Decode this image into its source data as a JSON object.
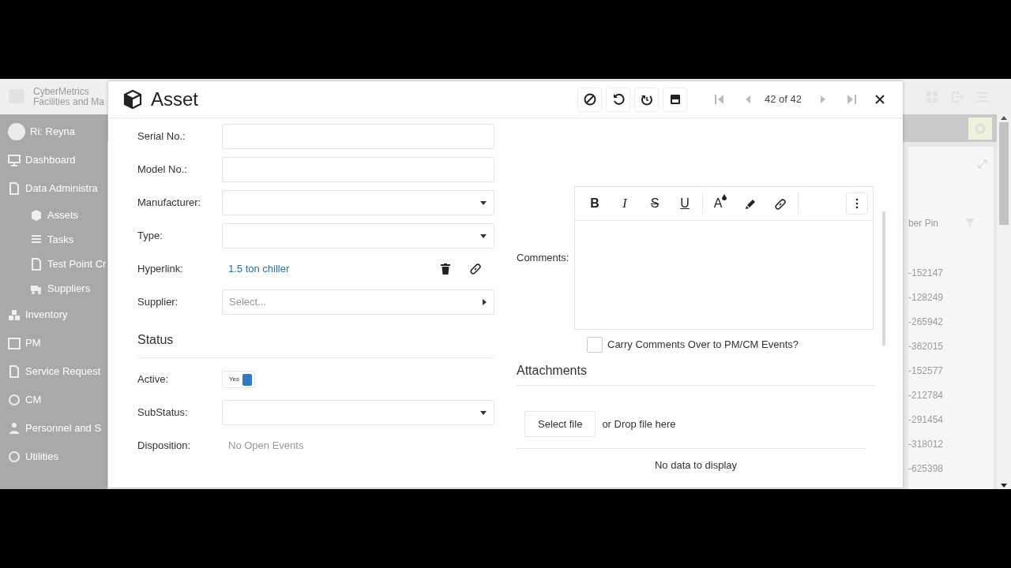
{
  "app_header": {
    "brand": "CyberMetrics",
    "tagline": "Facilities and Ma"
  },
  "sidebar": {
    "user": "Ri: Reyna",
    "items": [
      {
        "label": "Dashboard"
      },
      {
        "label": "Data Administra",
        "children": [
          {
            "label": "Assets"
          },
          {
            "label": "Tasks"
          },
          {
            "label": "Test Point Cr"
          },
          {
            "label": "Suppliers"
          }
        ]
      },
      {
        "label": "Inventory"
      },
      {
        "label": "PM"
      },
      {
        "label": "Service Request"
      },
      {
        "label": "CM"
      },
      {
        "label": "Personnel and S"
      },
      {
        "label": "Utilities"
      }
    ]
  },
  "background_table": {
    "column_header": "ber Pin",
    "cells": [
      "-152147",
      "-128249",
      "-265942",
      "-362015",
      "-152577",
      "-212784",
      "-291454",
      "-318012",
      "-625398"
    ]
  },
  "dialog": {
    "title": "Asset",
    "record_position": "42 of 42",
    "fields": [
      {
        "kind": "text",
        "label": "Serial No.:"
      },
      {
        "kind": "text",
        "label": "Model No.:"
      },
      {
        "kind": "dropdown",
        "label": "Manufacturer:"
      },
      {
        "kind": "dropdown",
        "label": "Type:"
      },
      {
        "kind": "link",
        "label": "Hyperlink:",
        "value": "1.5 ton chiller"
      },
      {
        "kind": "select",
        "label": "Supplier:",
        "placeholder": "Select..."
      }
    ],
    "status": {
      "heading": "Status",
      "fields": [
        {
          "kind": "toggle",
          "label": "Active:",
          "value": "Yes",
          "on": true
        },
        {
          "kind": "dropdown",
          "label": "SubStatus:"
        },
        {
          "kind": "static",
          "label": "Disposition:",
          "value": "No Open Events"
        }
      ]
    },
    "comments": {
      "label": "Comments:",
      "format_buttons": [
        "B",
        "I",
        "S",
        "U"
      ],
      "color_button": "A",
      "carry_over": {
        "label": "Carry Comments Over to PM/CM Events?",
        "checked": false
      }
    },
    "attachments": {
      "heading": "Attachments",
      "button": "Select file",
      "drop_hint": "or Drop file here",
      "empty": "No data to display"
    }
  }
}
